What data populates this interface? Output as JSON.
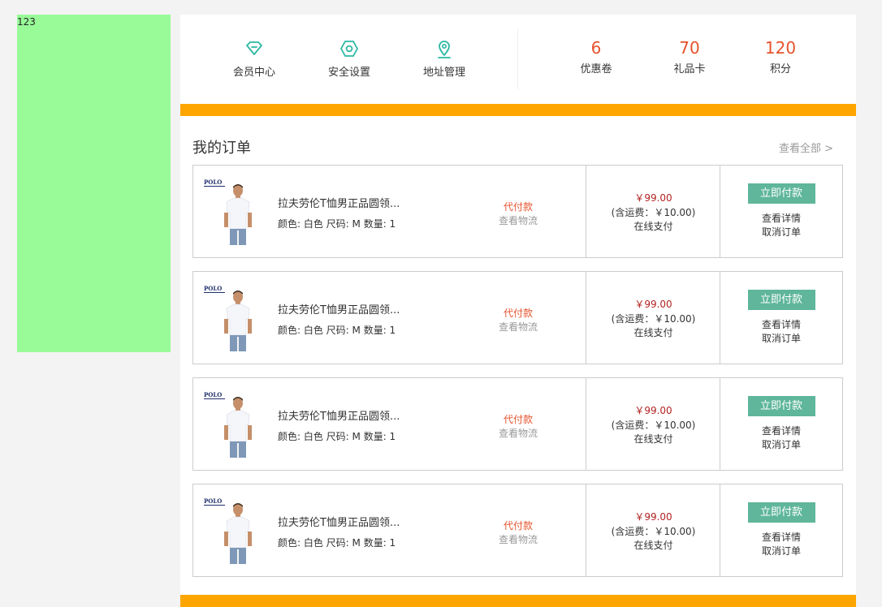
{
  "side_panel": {
    "text": "123"
  },
  "quick_links": [
    {
      "label": "会员中心",
      "icon": "gem-icon"
    },
    {
      "label": "安全设置",
      "icon": "shield-icon"
    },
    {
      "label": "地址管理",
      "icon": "location-pin-icon"
    }
  ],
  "stats": [
    {
      "value": "6",
      "label": "优惠卷"
    },
    {
      "value": "70",
      "label": "礼品卡"
    },
    {
      "value": "120",
      "label": "积分"
    }
  ],
  "orders_section": {
    "title": "我的订单",
    "view_all": "查看全部 >"
  },
  "orders": [
    {
      "name": "拉夫劳伦T恤男正品圆领...",
      "attrs": "颜色: 白色 尺码: M 数量: 1",
      "status": "代付款",
      "logistics": "查看物流",
      "price": "￥99.00",
      "shipping": "(含运费：￥10.00)",
      "payment": "在线支付",
      "pay_button": "立即付款",
      "detail": "查看详情",
      "cancel": "取消订单",
      "brand": "POLO"
    },
    {
      "name": "拉夫劳伦T恤男正品圆领...",
      "attrs": "颜色: 白色 尺码: M 数量: 1",
      "status": "代付款",
      "logistics": "查看物流",
      "price": "￥99.00",
      "shipping": "(含运费：￥10.00)",
      "payment": "在线支付",
      "pay_button": "立即付款",
      "detail": "查看详情",
      "cancel": "取消订单",
      "brand": "POLO"
    },
    {
      "name": "拉夫劳伦T恤男正品圆领...",
      "attrs": "颜色: 白色 尺码: M 数量: 1",
      "status": "代付款",
      "logistics": "查看物流",
      "price": "￥99.00",
      "shipping": "(含运费：￥10.00)",
      "payment": "在线支付",
      "pay_button": "立即付款",
      "detail": "查看详情",
      "cancel": "取消订单",
      "brand": "POLO"
    },
    {
      "name": "拉夫劳伦T恤男正品圆领...",
      "attrs": "颜色: 白色 尺码: M 数量: 1",
      "status": "代付款",
      "logistics": "查看物流",
      "price": "￥99.00",
      "shipping": "(含运费：￥10.00)",
      "payment": "在线支付",
      "pay_button": "立即付款",
      "detail": "查看详情",
      "cancel": "取消订单",
      "brand": "POLO"
    }
  ],
  "colors": {
    "accent": "#5fb69a",
    "highlight": "#e6522c",
    "band": "#ffa500",
    "side_panel": "#98fb98"
  }
}
